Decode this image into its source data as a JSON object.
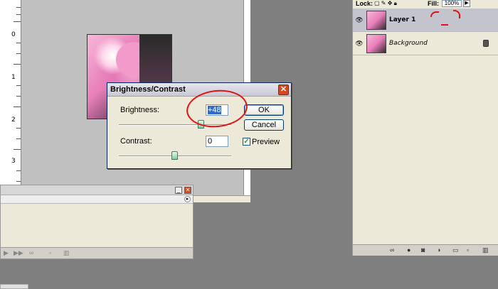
{
  "ruler": {
    "labels": [
      "0",
      "1",
      "2",
      "3"
    ]
  },
  "dialog": {
    "title": "Brightness/Contrast",
    "close_glyph": "✕",
    "brightness_label": "Brightness:",
    "brightness_value": "+48",
    "contrast_label": "Contrast:",
    "contrast_value": "0",
    "ok_label": "OK",
    "cancel_label": "Cancel",
    "preview_label": "Preview",
    "preview_checked": true,
    "check_glyph": "✓"
  },
  "layers": {
    "lock_label": "Lock:",
    "fill_label": "Fill:",
    "fill_value": "100%",
    "arrow_glyph": "▶",
    "items": [
      {
        "name": "Layer 1",
        "visible": true,
        "active": true
      },
      {
        "name": "Background",
        "visible": true,
        "locked": true
      }
    ]
  },
  "palette_bl": {
    "minimize_glyph": "_",
    "close_glyph": "✕",
    "menu_glyph": "▸"
  },
  "colors": {
    "annotation": "#e01212",
    "background": "#7f7f7f",
    "dialog_bg": "#ece9d8"
  }
}
